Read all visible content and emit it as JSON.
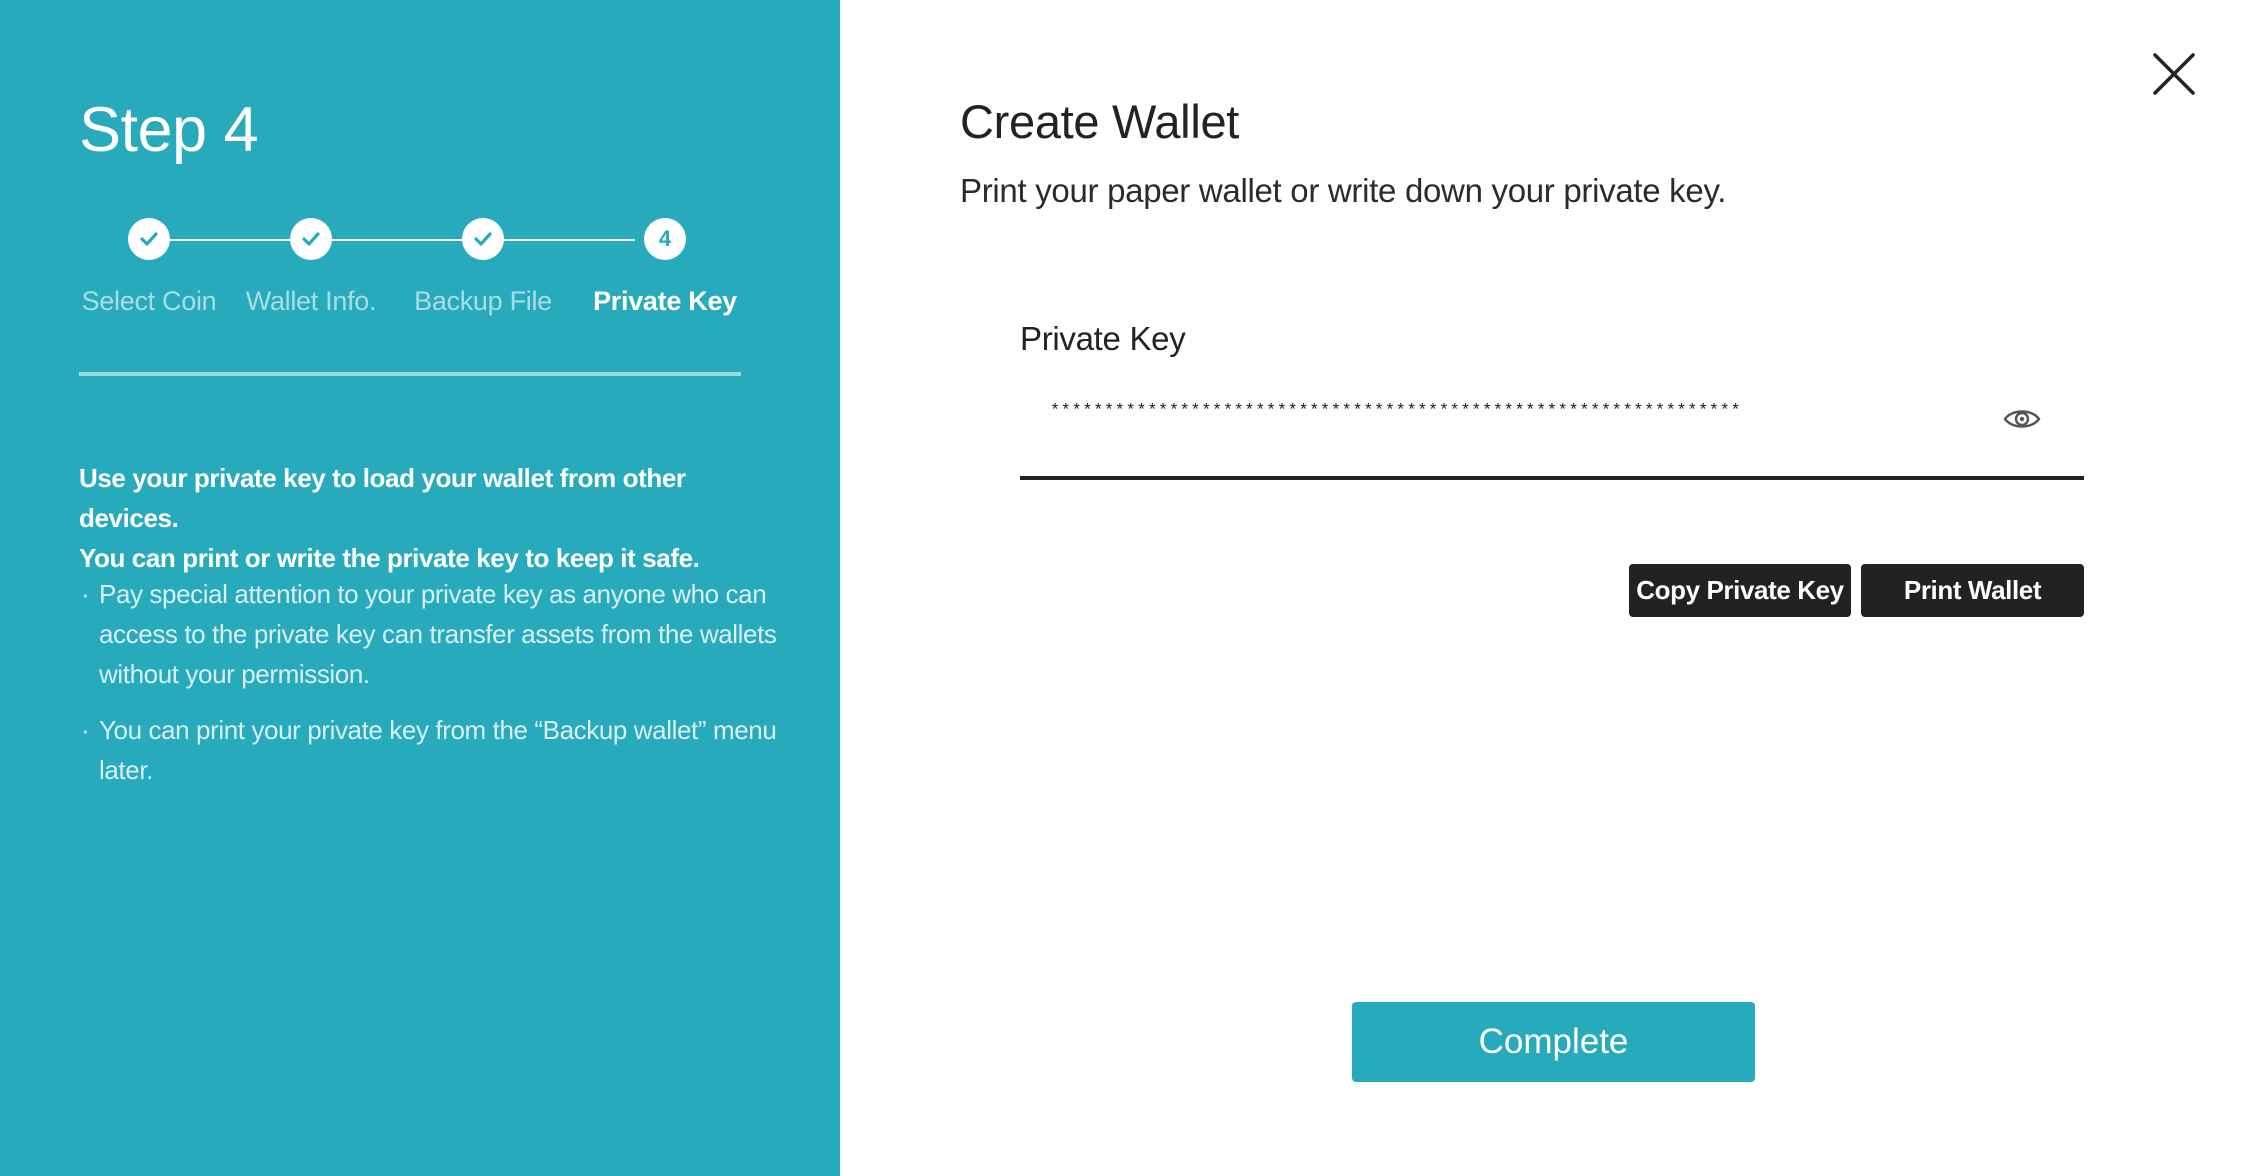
{
  "colors": {
    "accent": "#27aabb",
    "dark_button": "#222222",
    "text": "#222222"
  },
  "sidebar": {
    "title": "Step 4",
    "steps": [
      {
        "label": "Select Coin",
        "state": "done",
        "icon": "check-icon"
      },
      {
        "label": "Wallet Info.",
        "state": "done",
        "icon": "check-icon"
      },
      {
        "label": "Backup File",
        "state": "done",
        "icon": "check-icon"
      },
      {
        "label": "Private Key",
        "state": "active",
        "number": "4"
      }
    ],
    "intro_line1": "Use your private key to load your wallet from other devices.",
    "intro_line2": "You can print or write the private key to keep it safe.",
    "bullet": "·",
    "notes": [
      "Pay special attention to your private key as anyone who can access to the private key can transfer assets from the wallets without your permission.",
      "You can print your private key from the “Backup wallet” menu later."
    ]
  },
  "dialog": {
    "close_icon": "close-icon",
    "title": "Create Wallet",
    "subtitle": "Print your paper wallet or write down your private key.",
    "field_label": "Private Key",
    "private_key_masked": "****************************************************************",
    "visibility_icon": "eye-icon",
    "copy_button": "Copy Private Key",
    "print_button": "Print Wallet",
    "complete_button": "Complete"
  }
}
